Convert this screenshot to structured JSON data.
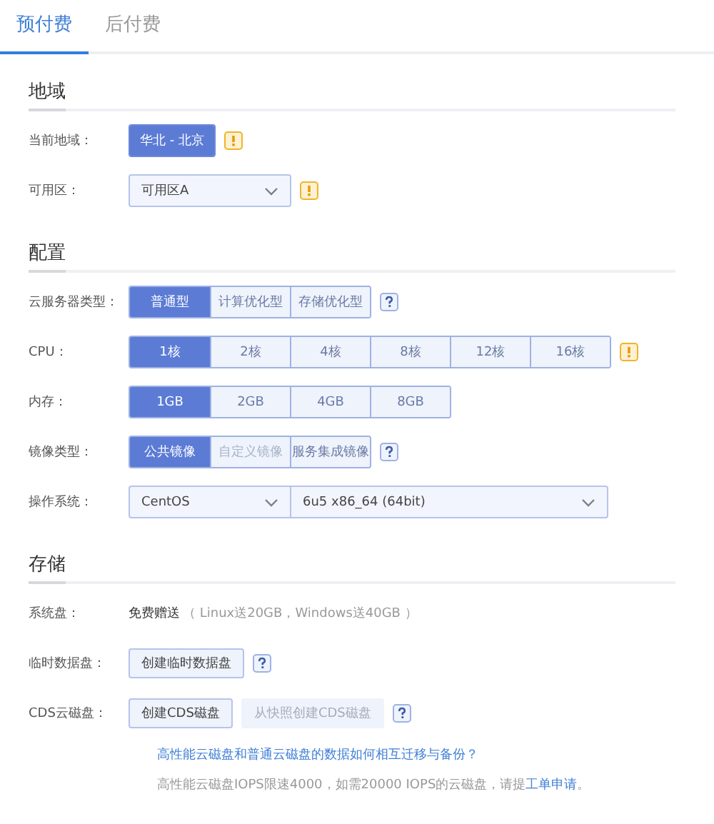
{
  "tabs": [
    {
      "label": "预付费",
      "selected": true
    },
    {
      "label": "后付费",
      "selected": false
    }
  ],
  "sections": [
    {
      "title": "地域",
      "rows": [
        {
          "kind": "button",
          "label": "当前地域：",
          "options": [
            {
              "label": "华北 - 北京",
              "selected": true,
              "disabled": false
            }
          ],
          "warning": true
        },
        {
          "kind": "dropdowns",
          "label": "可用区：",
          "fields": [
            {
              "value": "可用区A"
            }
          ],
          "warning": true
        }
      ]
    },
    {
      "title": "配置",
      "rows": [
        {
          "kind": "segmented",
          "label": "云服务器类型：",
          "options": [
            {
              "label": "普通型",
              "selected": true,
              "disabled": false
            },
            {
              "label": "计算优化型",
              "selected": false,
              "disabled": false
            },
            {
              "label": "存储优化型",
              "selected": false,
              "disabled": false
            }
          ],
          "help": true
        },
        {
          "kind": "segmented",
          "label": "CPU：",
          "options": [
            {
              "label": "1核",
              "selected": true,
              "disabled": false
            },
            {
              "label": "2核",
              "selected": false,
              "disabled": false
            },
            {
              "label": "4核",
              "selected": false,
              "disabled": false
            },
            {
              "label": "8核",
              "selected": false,
              "disabled": false
            },
            {
              "label": "12核",
              "selected": false,
              "disabled": false
            },
            {
              "label": "16核",
              "selected": false,
              "disabled": false
            }
          ],
          "warning": true
        },
        {
          "kind": "segmented",
          "label": "内存：",
          "options": [
            {
              "label": "1GB",
              "selected": true,
              "disabled": false
            },
            {
              "label": "2GB",
              "selected": false,
              "disabled": false
            },
            {
              "label": "4GB",
              "selected": false,
              "disabled": false
            },
            {
              "label": "8GB",
              "selected": false,
              "disabled": false
            }
          ]
        },
        {
          "kind": "segmented",
          "label": "镜像类型：",
          "options": [
            {
              "label": "公共镜像",
              "selected": true,
              "disabled": false
            },
            {
              "label": "自定义镜像",
              "selected": false,
              "disabled": true
            },
            {
              "label": "服务集成镜像",
              "selected": false,
              "disabled": false
            }
          ],
          "help": true
        },
        {
          "kind": "dropdowns",
          "label": "操作系统：",
          "fields": [
            {
              "value": "CentOS"
            },
            {
              "value": "6u5 x86_64 (64bit)"
            }
          ]
        }
      ]
    },
    {
      "title": "存储",
      "rows": [
        {
          "kind": "text",
          "label": "系统盘：",
          "value": "免费赠送",
          "note": "（ Linux送20GB，Windows送40GB ）"
        },
        {
          "kind": "actions",
          "label": "临时数据盘：",
          "buttons": [
            {
              "label": "创建临时数据盘",
              "disabled": false
            }
          ],
          "help": true
        },
        {
          "kind": "actions",
          "label": "CDS云磁盘：",
          "buttons": [
            {
              "label": "创建CDS磁盘",
              "disabled": false
            },
            {
              "label": "从快照创建CDS磁盘",
              "disabled": true
            }
          ],
          "help": true
        }
      ],
      "link": "高性能云磁盘和普通云磁盘的数据如何相互迁移与备份？",
      "note": {
        "text": "高性能云磁盘IOPS限速4000，如需20000 IOPS的云磁盘，请提",
        "link": "工单申请",
        "end": "。"
      }
    }
  ]
}
